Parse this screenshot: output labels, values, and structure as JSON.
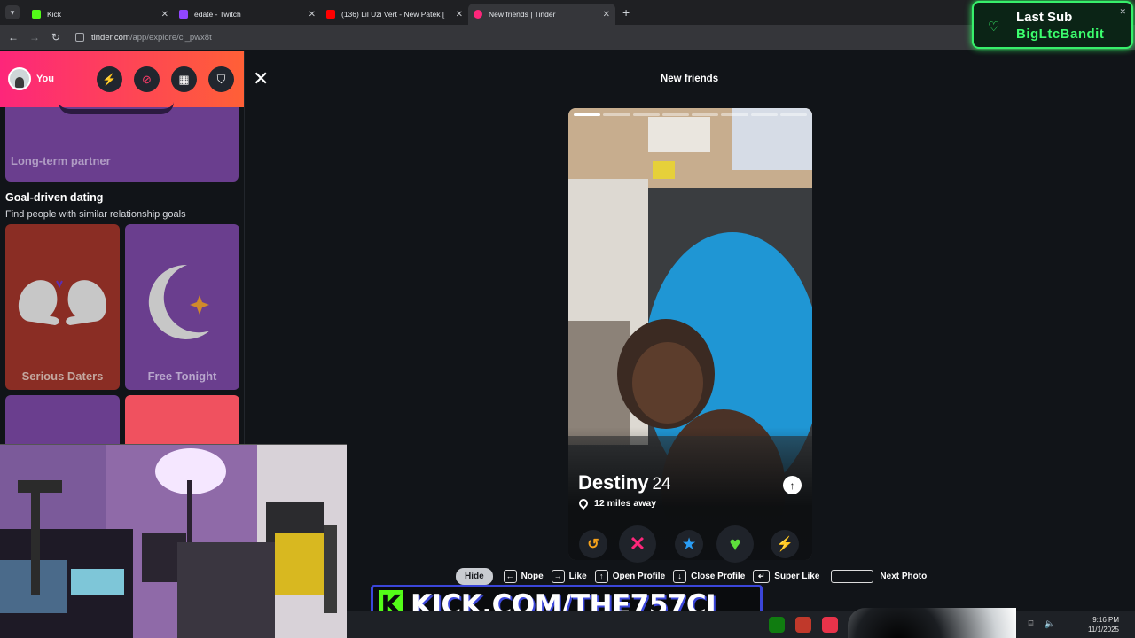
{
  "browser": {
    "tabs": [
      {
        "title": "Kick",
        "color": "#53fc18",
        "active": false
      },
      {
        "title": "edate - Twitch",
        "color": "#9146ff",
        "active": false
      },
      {
        "title": "(136) Lil Uzi Vert - New Patek [",
        "color": "#ff0000",
        "active": false
      },
      {
        "title": "New friends | Tinder",
        "color": "#fd267a",
        "active": true
      }
    ],
    "url_domain": "tinder.com",
    "url_path": "/app/explore/cl_pwx8t"
  },
  "overlay_lastsub": {
    "label": "Last Sub",
    "name": "BigLtcBandit"
  },
  "sidebar": {
    "user_label": "You",
    "partial_card_label": "Long-term partner",
    "section_title": "Goal-driven dating",
    "section_subtitle": "Find people with similar relationship goals",
    "tiles": [
      {
        "label": "Serious Daters"
      },
      {
        "label": "Free Tonight"
      }
    ]
  },
  "main": {
    "page_title": "New friends",
    "profile": {
      "name": "Destiny",
      "age": "24",
      "distance": "12 miles away"
    },
    "shortcuts": {
      "hide": "Hide",
      "nope": "Nope",
      "like": "Like",
      "open_profile": "Open Profile",
      "close_profile": "Close Profile",
      "super_like": "Super Like",
      "next_photo": "Next Photo"
    }
  },
  "stream_banner": {
    "k": "K",
    "url": "KICK.COM/THE757CJ"
  },
  "taskbar": {
    "time": "9:16 PM",
    "date": "11/1/2025"
  },
  "colors": {
    "tinder_gradient_start": "#fd267a",
    "tinder_gradient_end": "#ff6036",
    "kick_green": "#53fc18",
    "banner_blue": "#3b46d9"
  }
}
